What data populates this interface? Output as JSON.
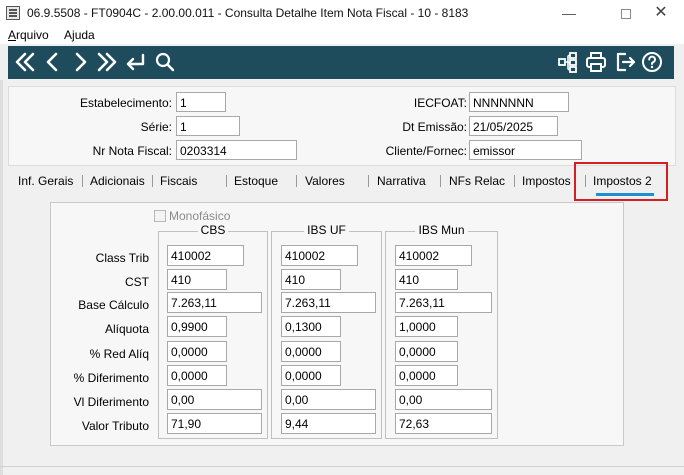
{
  "window": {
    "title": "06.9.5508 - FT0904C - 2.00.00.011 - Consulta Detalhe Item Nota Fiscal - 10 - 8183",
    "minimize_glyph": "—",
    "close_glyph": "✕"
  },
  "menu": {
    "items": [
      {
        "label_u": "A",
        "label_rest": "rquivo"
      },
      {
        "label_u": "A",
        "label_rest": "juda"
      }
    ]
  },
  "toolbar": {
    "icons": [
      "first-record-icon",
      "previous-record-icon",
      "next-record-icon",
      "last-record-icon",
      "return-icon",
      "search-icon",
      "hierarchy-icon",
      "print-icon",
      "exit-icon",
      "help-icon"
    ],
    "color": "#1e4c5c"
  },
  "header": {
    "estabelecimento": {
      "label": "Estabelecimento:",
      "value": "1"
    },
    "serie": {
      "label": "Série:",
      "value": "1"
    },
    "nr_nota": {
      "label": "Nr Nota Fiscal:",
      "value": "0203314"
    },
    "iecfoat": {
      "label": "IECFOAT:",
      "value": "NNNNNNN"
    },
    "dt_emissao": {
      "label": "Dt Emissão:",
      "value": "21/05/2025"
    },
    "cliente": {
      "label": "Cliente/Fornec:",
      "value": "emissor"
    }
  },
  "tabs": [
    {
      "label": "Inf. Gerais"
    },
    {
      "label": "Adicionais"
    },
    {
      "label": "Fiscais"
    },
    {
      "label": "Estoque"
    },
    {
      "label": "Valores"
    },
    {
      "label": "Narrativa"
    },
    {
      "label": "NFs Relac"
    },
    {
      "label": "Impostos"
    },
    {
      "label": "Impostos 2",
      "active": true
    }
  ],
  "accent_color": "#1e8fd0",
  "highlight_color": "#d21f1f",
  "impostos2": {
    "monofasico_label": "Monofásico",
    "monofasico_checked": false,
    "row_labels": [
      "Class Trib",
      "CST",
      "Base Cálculo",
      "Alíquota",
      "% Red Alíq",
      "% Diferimento",
      "Vl Diferimento",
      "Valor Tributo"
    ],
    "groups": [
      {
        "title": "CBS",
        "values": [
          "410002",
          "410",
          "7.263,11",
          "0,9900",
          "0,0000",
          "0,0000",
          "0,00",
          "71,90"
        ]
      },
      {
        "title": "IBS UF",
        "values": [
          "410002",
          "410",
          "7.263,11",
          "0,1300",
          "0,0000",
          "0,0000",
          "0,00",
          "9,44"
        ]
      },
      {
        "title": "IBS Mun",
        "values": [
          "410002",
          "410",
          "7.263,11",
          "1,0000",
          "0,0000",
          "0,0000",
          "0,00",
          "72,63"
        ]
      }
    ]
  }
}
